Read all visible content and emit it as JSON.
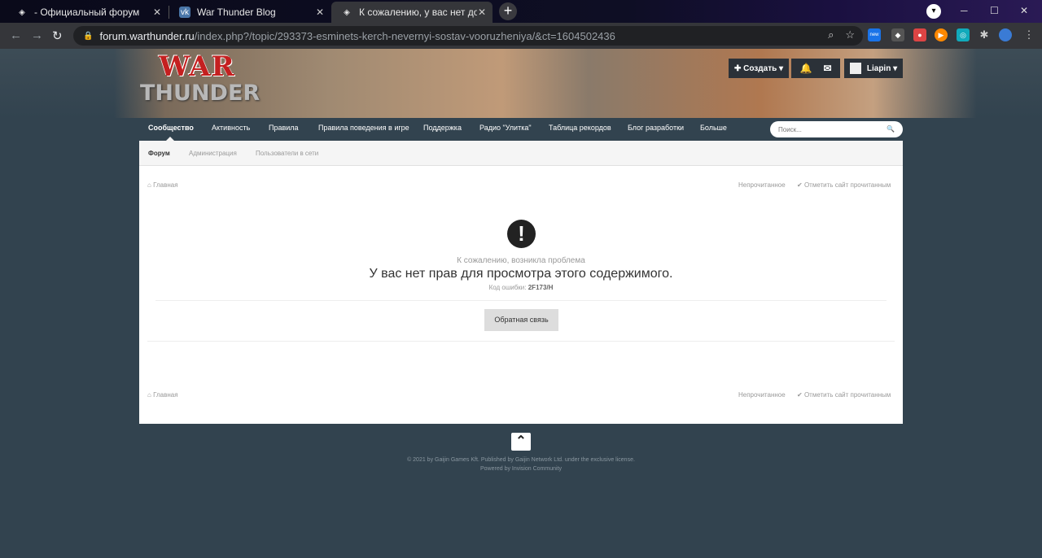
{
  "browser": {
    "tabs": [
      {
        "title": "- Официальный форум",
        "icon": "warthunder-favicon"
      },
      {
        "title": "War Thunder Blog",
        "icon": "vk-favicon"
      },
      {
        "title": "К сожалению, у вас нет доступа",
        "icon": "warthunder-favicon"
      }
    ],
    "url_host": "forum.warthunder.ru",
    "url_path": "/index.php?/topic/293373-esminets-kerch-nevernyi-sostav-vooruzheniya/&ct=1604502436",
    "window_controls": {
      "minimize": "─",
      "maximize": "☐",
      "close": "✕"
    }
  },
  "site": {
    "logo_top": "WAR",
    "logo_bottom": "THUNDER",
    "create_label": "✚ Создать ▾",
    "user_label": "Liapin ▾",
    "main_nav": [
      "Сообщество",
      "Активность",
      "Правила",
      "Правила поведения в игре",
      "Поддержка",
      "Радио \"Улитка\"",
      "Таблица рекордов",
      "Блог разработки",
      "Больше"
    ],
    "search_placeholder": "Поиск...",
    "sub_nav": [
      "Форум",
      "Администрация",
      "Пользователи в сети"
    ],
    "breadcrumb_home": "Главная",
    "unread": "Непрочитанное",
    "mark_read": "Отметить сайт прочитанным",
    "error": {
      "subtitle": "К сожалению, возникла проблема",
      "title": "У вас нет прав для просмотра этого содержимого.",
      "code_label": "Код ошибки:",
      "code": "2F173/H",
      "button": "Обратная связь"
    },
    "copyright": "© 2021 by Gaijin Games Kft. Published by Gaijin Network Ltd. under the exclusive license.",
    "powered": "Powered by Invision Community"
  },
  "colors": {
    "page_bg": "#32434f",
    "content_bg": "#ffffff",
    "tab_active": "#35363a"
  }
}
